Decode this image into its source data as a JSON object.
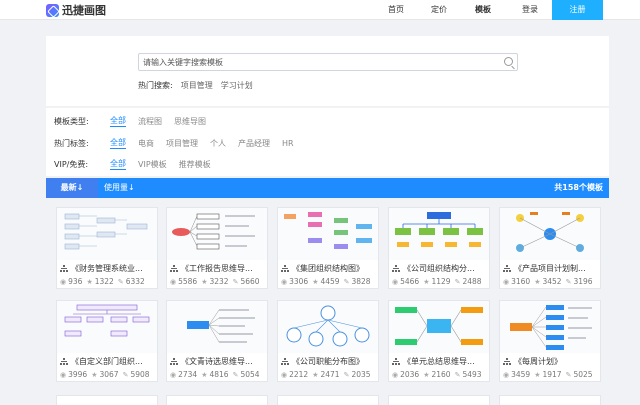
{
  "header": {
    "logo_text": "迅捷画图",
    "nav": [
      "首页",
      "定价",
      "模板",
      "登录"
    ],
    "register": "注册"
  },
  "search": {
    "placeholder": "请输入关键字搜索模板",
    "hot_label": "热门搜索:",
    "hot_keywords": [
      "项目管理",
      "学习计划"
    ]
  },
  "filters": {
    "type": {
      "label": "模板类型:",
      "options": [
        "全部",
        "流程图",
        "思维导图"
      ]
    },
    "tags": {
      "label": "热门标签:",
      "options": [
        "全部",
        "电商",
        "项目管理",
        "个人",
        "产品经理",
        "HR"
      ]
    },
    "vip": {
      "label": "VIP/免费:",
      "options": [
        "全部",
        "VIP模板",
        "推荐模板"
      ]
    }
  },
  "sort": {
    "newest": "最新↓",
    "usage": "使用量↓",
    "total": "共158个模板"
  },
  "cards": [
    {
      "title": "《财务管理系统业...",
      "views": "936",
      "likes": "1322",
      "uses": "6332"
    },
    {
      "title": "《工作报告思维导...",
      "views": "5586",
      "likes": "3232",
      "uses": "5660"
    },
    {
      "title": "《集团组织结构图》",
      "views": "3306",
      "likes": "4459",
      "uses": "3828"
    },
    {
      "title": "《公司组织结构分...",
      "views": "5466",
      "likes": "1129",
      "uses": "2488"
    },
    {
      "title": "《产品项目计划制...",
      "views": "3160",
      "likes": "3452",
      "uses": "3196"
    },
    {
      "title": "《自定义部门组织...",
      "views": "3996",
      "likes": "3067",
      "uses": "5908"
    },
    {
      "title": "《文青诗选思维导...",
      "views": "2734",
      "likes": "4816",
      "uses": "5054"
    },
    {
      "title": "《公司职能分布图》",
      "views": "2212",
      "likes": "2471",
      "uses": "2035"
    },
    {
      "title": "《单元总结思维导...",
      "views": "2036",
      "likes": "2160",
      "uses": "5493"
    },
    {
      "title": "《每周计划》",
      "views": "3459",
      "likes": "1917",
      "uses": "5025"
    }
  ]
}
